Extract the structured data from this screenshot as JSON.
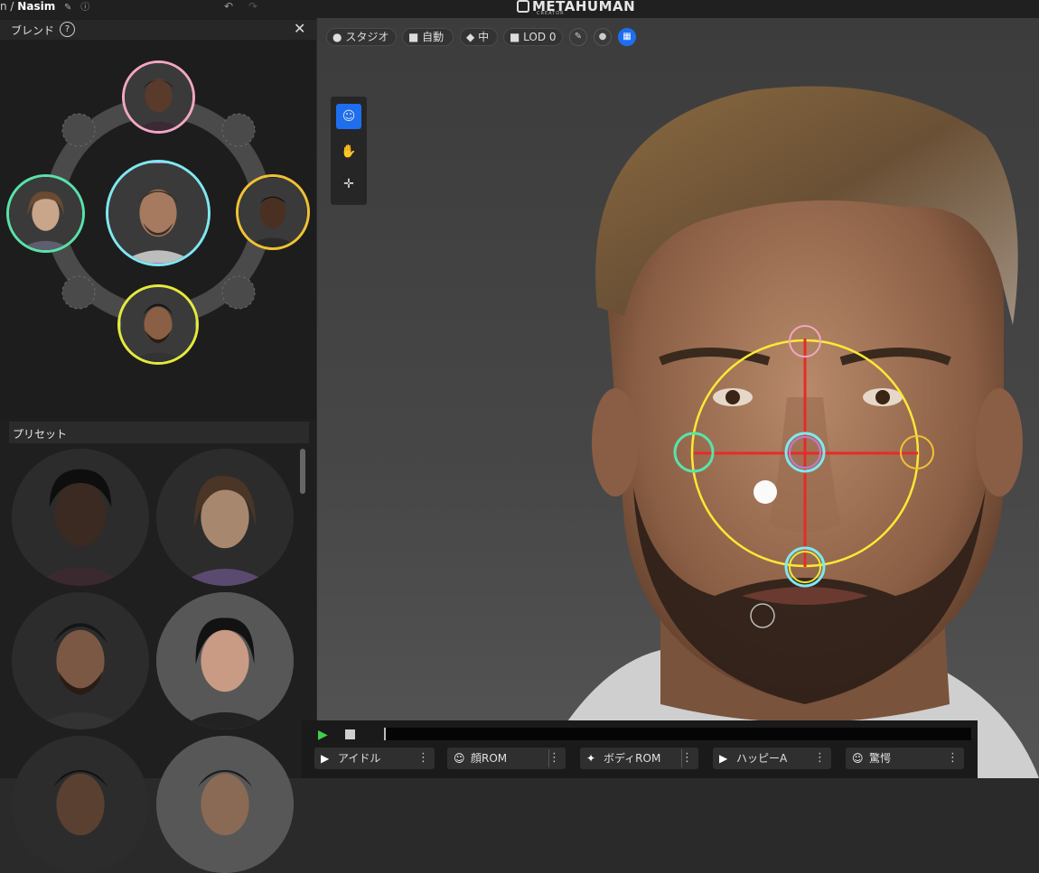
{
  "topbar": {
    "crumb_prefix": "n /",
    "character_name": "Nasim",
    "edit_icon": "pencil-icon",
    "help_icon": "help-icon",
    "undo_icon": "undo-icon",
    "redo_icon": "redo-icon",
    "logo_text": "METAHUMAN",
    "logo_sub": "CREATOR"
  },
  "blend_panel": {
    "title": "ブレンド",
    "help_label": "?",
    "close_label": "✕",
    "faces": [
      {
        "name": "top-face",
        "ring_color": "#f2a6c4",
        "skin": "#5a3a2a"
      },
      {
        "name": "left-face",
        "ring_color": "#59e3a9",
        "skin": "#c9a58a"
      },
      {
        "name": "center-face",
        "ring_color": "#7fe8f0",
        "skin": "#a57a5f"
      },
      {
        "name": "right-face",
        "ring_color": "#f1c232",
        "skin": "#4a3022"
      },
      {
        "name": "bottom-face",
        "ring_color": "#e6ea3a",
        "skin": "#8a5f44"
      }
    ]
  },
  "presets": {
    "title": "プリセット",
    "items": [
      {
        "skin": "#3a2a22"
      },
      {
        "skin": "#a8876f"
      },
      {
        "skin": "#7b5843"
      },
      {
        "skin": "#c99a84"
      },
      {
        "skin": "#5a4030"
      },
      {
        "skin": "#8a6a55"
      }
    ]
  },
  "viewport": {
    "toolbar": {
      "lighting_label": "スタジオ",
      "camera_label": "自動",
      "quality_label": "中",
      "lod_label": "LOD 0"
    },
    "tools": {
      "face_tool_icon": "face-icon",
      "paint_tool_icon": "hand-icon",
      "move_tool_icon": "move-icon"
    }
  },
  "playback": {
    "play_icon": "play-icon",
    "stop_icon": "stop-icon",
    "animations": [
      {
        "icon": "play-circle-icon",
        "label": "アイドル"
      },
      {
        "icon": "face-icon",
        "label": "顔ROM"
      },
      {
        "icon": "running-icon",
        "label": "ボディROM"
      },
      {
        "icon": "play-circle-icon",
        "label": "ハッピーA"
      },
      {
        "icon": "face-icon",
        "label": "驚愕"
      }
    ],
    "menu_label": "⋮"
  },
  "colors": {
    "accent": "#1e6ff0",
    "play_green": "#3fd04a",
    "gizmo_yellow": "#ffe833",
    "gizmo_red": "#e82a2a"
  }
}
